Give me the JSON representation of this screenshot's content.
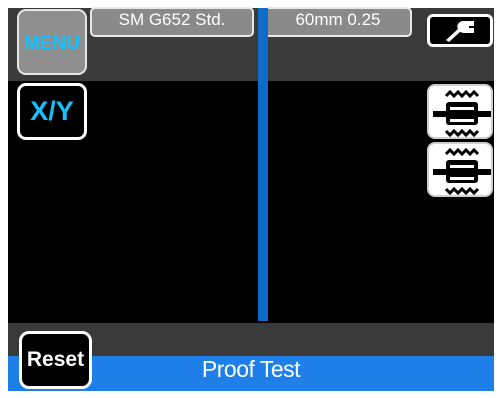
{
  "header": {
    "menu_label": "MENU",
    "fiber_type": "SM G652 Std.",
    "cleave_setting": "60mm 0.25",
    "wrench_icon": "wrench-icon"
  },
  "buttons": {
    "xy_label": "X/Y",
    "reset_label": "Reset",
    "motor_up_icon": "fiber-motor-icon",
    "motor_down_icon": "fiber-motor-icon"
  },
  "status": {
    "text": "Proof Test"
  },
  "colors": {
    "accent_cyan": "#12c3ff",
    "status_blue": "#1e7fe8",
    "fiber_blue": "#0c6cc7",
    "panel_gray": "#3a3a3a"
  }
}
